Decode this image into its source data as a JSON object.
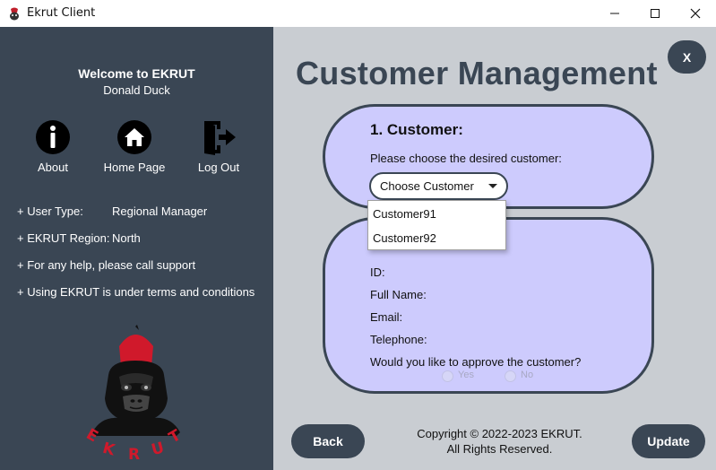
{
  "window": {
    "title": "Ekrut Client"
  },
  "sidebar": {
    "welcome": "Welcome to EKRUT",
    "username": "Donald Duck",
    "nav": {
      "about": "About",
      "home": "Home Page",
      "logout": "Log Out"
    },
    "info": {
      "user_type_label": "+ User Type:",
      "user_type_value": "Regional Manager",
      "region_label": "+ EKRUT Region:",
      "region_value": "North",
      "help": "+ For any help, please call support",
      "terms": "+ Using EKRUT is under terms and conditions"
    },
    "logo_text": "EKRUT"
  },
  "main": {
    "title": "Customer Management",
    "exit_label": "X",
    "customer_card": {
      "title": "1. Customer:",
      "prompt": "Please choose the desired customer:",
      "combo_value": "Choose Customer",
      "options": [
        "Customer91",
        "Customer92"
      ]
    },
    "details_card": {
      "id_label": "ID:",
      "full_name_label": "Full Name:",
      "email_label": "Email:",
      "telephone_label": "Telephone:",
      "approve_question": "Would you like to approve the customer?",
      "yes_label": "Yes",
      "no_label": "No"
    },
    "back_label": "Back",
    "update_label": "Update",
    "copyright_line1": "Copyright © 2022-2023 EKRUT.",
    "copyright_line2": "All Rights Reserved."
  },
  "colors": {
    "sidebar_bg": "#3a4654",
    "main_bg": "#c9cdd2",
    "card_bg": "#cdcbfd",
    "logo_red": "#d0192b"
  }
}
